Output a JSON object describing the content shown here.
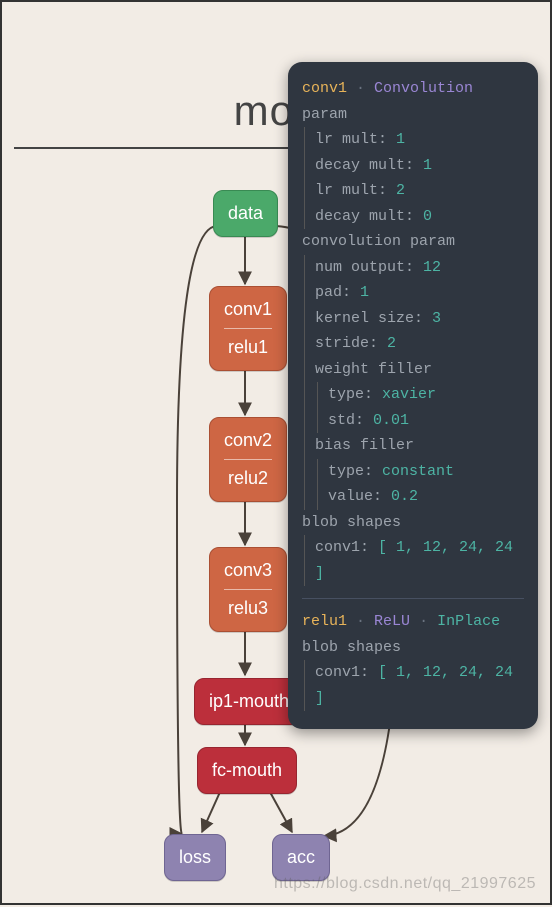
{
  "title": "mou",
  "nodes": {
    "data": "data",
    "conv1": "conv1",
    "relu1": "relu1",
    "conv2": "conv2",
    "relu2": "relu2",
    "conv3": "conv3",
    "relu3": "relu3",
    "ip1": "ip1-mouth",
    "fc": "fc-mouth",
    "loss": "loss",
    "acc": "acc"
  },
  "tooltip1": {
    "layer": "conv1",
    "type": "Convolution",
    "param_label": "param",
    "params": [
      {
        "k": "lr mult",
        "v": "1"
      },
      {
        "k": "decay mult",
        "v": "1"
      },
      {
        "k": "lr mult",
        "v": "2"
      },
      {
        "k": "decay mult",
        "v": "0"
      }
    ],
    "convparam_label": "convolution param",
    "convparams": [
      {
        "k": "num output",
        "v": "12"
      },
      {
        "k": "pad",
        "v": "1"
      },
      {
        "k": "kernel size",
        "v": "3"
      },
      {
        "k": "stride",
        "v": "2"
      }
    ],
    "weightfiller_label": "weight filler",
    "weightfiller": [
      {
        "k": "type",
        "v": "xavier"
      },
      {
        "k": "std",
        "v": "0.01"
      }
    ],
    "biasfiller_label": "bias filler",
    "biasfiller": [
      {
        "k": "type",
        "v": "constant"
      },
      {
        "k": "value",
        "v": "0.2"
      }
    ],
    "blobshapes_label": "blob shapes",
    "blob_k": "conv1",
    "blob_v": "[ 1, 12, 24, 24 ]"
  },
  "tooltip2": {
    "layer": "relu1",
    "type": "ReLU",
    "inplace": "InPlace",
    "blobshapes_label": "blob shapes",
    "blob_k": "conv1",
    "blob_v": "[ 1, 12, 24, 24 ]"
  },
  "watermark": "https://blog.csdn.net/qq_21997625",
  "chart_data": {
    "type": "diagram",
    "description": "Neural network architecture graph (Caffe-style) with layer tooltip",
    "nodes": [
      "data",
      "conv1/relu1",
      "conv2/relu2",
      "conv3/relu3",
      "ip1-mouth",
      "fc-mouth",
      "loss",
      "acc"
    ],
    "edges": [
      [
        "data",
        "conv1"
      ],
      [
        "conv1",
        "conv2"
      ],
      [
        "conv2",
        "conv3"
      ],
      [
        "conv3",
        "ip1-mouth"
      ],
      [
        "ip1-mouth",
        "fc-mouth"
      ],
      [
        "fc-mouth",
        "loss"
      ],
      [
        "fc-mouth",
        "acc"
      ],
      [
        "data",
        "loss"
      ],
      [
        "data",
        "acc"
      ]
    ]
  }
}
